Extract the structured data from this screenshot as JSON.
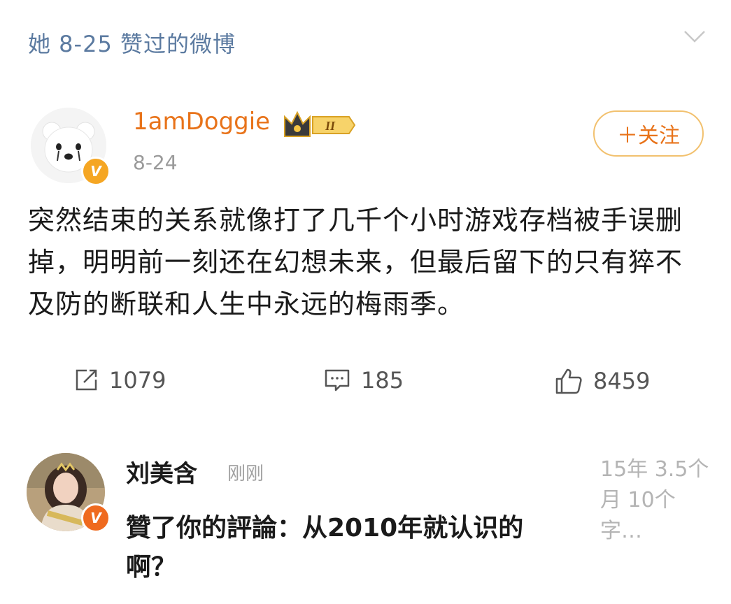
{
  "header": {
    "title": "她 8-25 赞过的微博"
  },
  "post": {
    "username": "1amDoggie",
    "level_badge": "II",
    "date": "8-24",
    "follow_label": "＋关注",
    "text": "突然结束的关系就像打了几千个小时游戏存档被手误删掉，明明前一刻还在幻想未来，但最后留下的只有猝不及防的断联和人生中永远的梅雨季。"
  },
  "actions": {
    "repost_count": "1079",
    "comment_count": "185",
    "like_count": "8459"
  },
  "comment": {
    "name": "刘美含",
    "time": "刚刚",
    "text": "贊了你的評論：从2010年就认识的啊？",
    "meta": "15年 3.5个月 10个字…"
  },
  "colors": {
    "header_blue": "#5b7aa0",
    "username_orange": "#e8731a",
    "badge_gold": "#f5a623"
  }
}
